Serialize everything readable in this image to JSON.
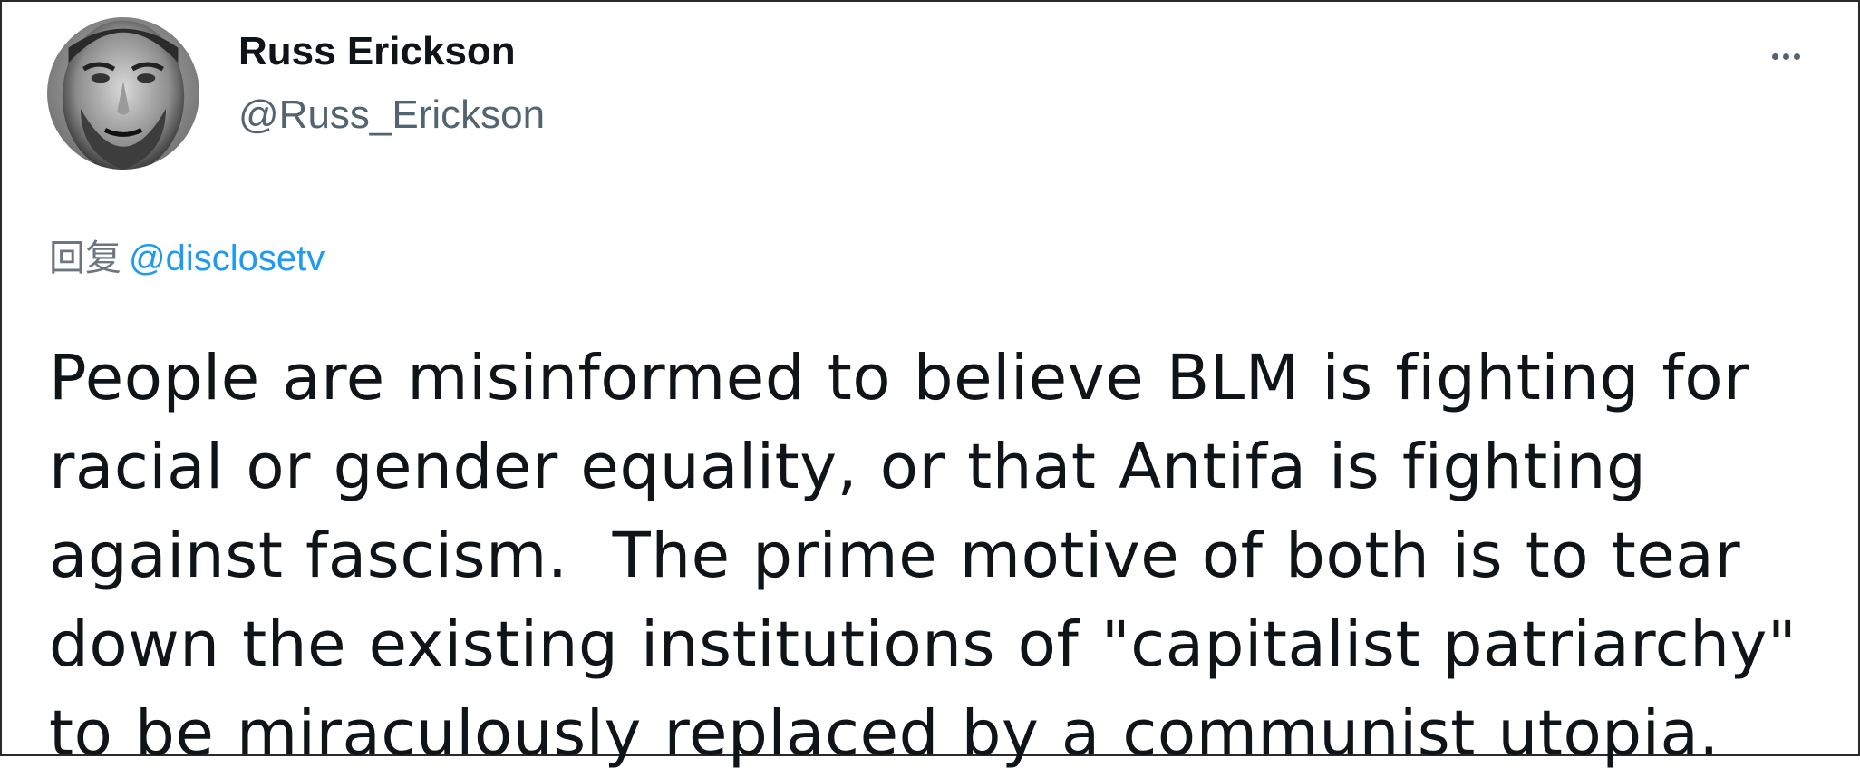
{
  "tweet": {
    "author": {
      "display_name": "Russ Erickson",
      "handle": "@Russ_Erickson",
      "avatar_icon": "user-avatar-photo"
    },
    "more_icon": "more-horizontal-icon",
    "reply": {
      "prefix": "回复",
      "mention": "@disclosetv"
    },
    "text_lines": [
      "People are misinformed to believe BLM is fighting for",
      "racial or gender equality, or that Antifa is fighting",
      "against fascism.  The prime motive of both is to tear",
      "down the existing institutions of \"capitalist patriarchy\"",
      "to be miraculously replaced by a communist utopia."
    ]
  },
  "colors": {
    "text_primary": "#0f1419",
    "text_secondary": "#536471",
    "link": "#1d9bf0",
    "border": "#2a2a2a"
  }
}
